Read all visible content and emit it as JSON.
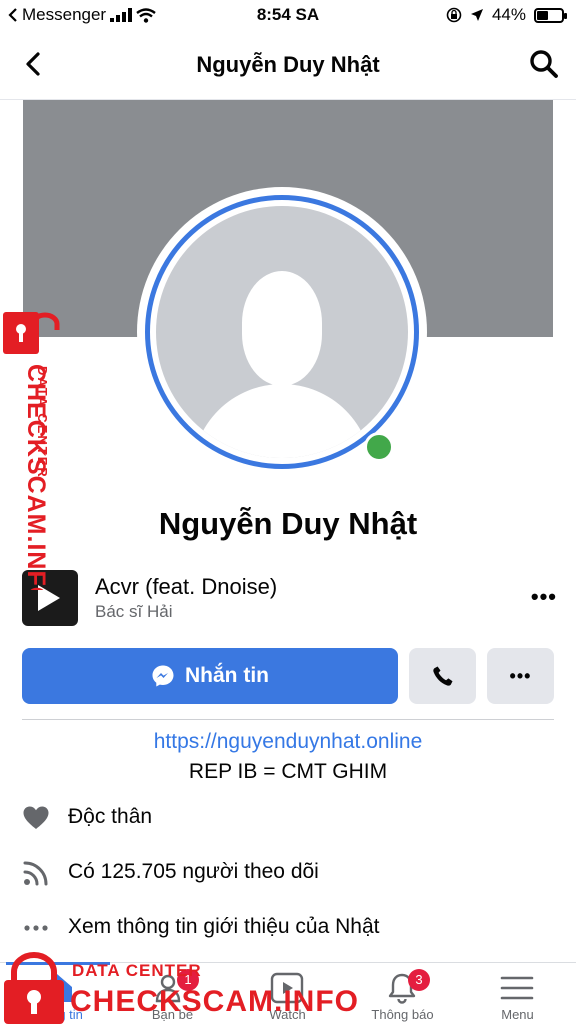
{
  "status_bar": {
    "carrier": "Messenger",
    "time": "8:54 SA",
    "battery": "44%",
    "battery_level": 0.44
  },
  "header": {
    "title": "Nguyễn Duy Nhật"
  },
  "profile": {
    "name": "Nguyễn Duy Nhật",
    "online": true
  },
  "music": {
    "song": "Acvr (feat. Dnoise)",
    "artist": "Bác sĩ Hải"
  },
  "actions": {
    "message_label": "Nhắn tin"
  },
  "bio": {
    "link": "https://nguyenduynhat.online",
    "text": "REP IB = CMT GHIM"
  },
  "details": [
    {
      "icon": "heart-icon",
      "text": "Độc thân"
    },
    {
      "icon": "rss-icon",
      "text": "Có 125.705 người theo dõi"
    },
    {
      "icon": "more-dots-icon",
      "text": "Xem thông tin giới thiệu của Nhật"
    }
  ],
  "tabs": [
    {
      "label": "Trang tin",
      "icon": "home-icon",
      "active": true
    },
    {
      "label": "Bạn bè",
      "icon": "friends-icon",
      "badge": "1"
    },
    {
      "label": "Watch",
      "icon": "watch-icon"
    },
    {
      "label": "Thông báo",
      "icon": "bell-icon",
      "badge": "3"
    },
    {
      "label": "Menu",
      "icon": "menu-icon"
    }
  ],
  "watermark": {
    "small": "DATA CENTER",
    "big": "CHECKSCAM.INFO"
  },
  "colors": {
    "accent": "#3b78e0",
    "online": "#42a84a",
    "badge": "#e41e3f",
    "watermark": "#e31e24"
  }
}
